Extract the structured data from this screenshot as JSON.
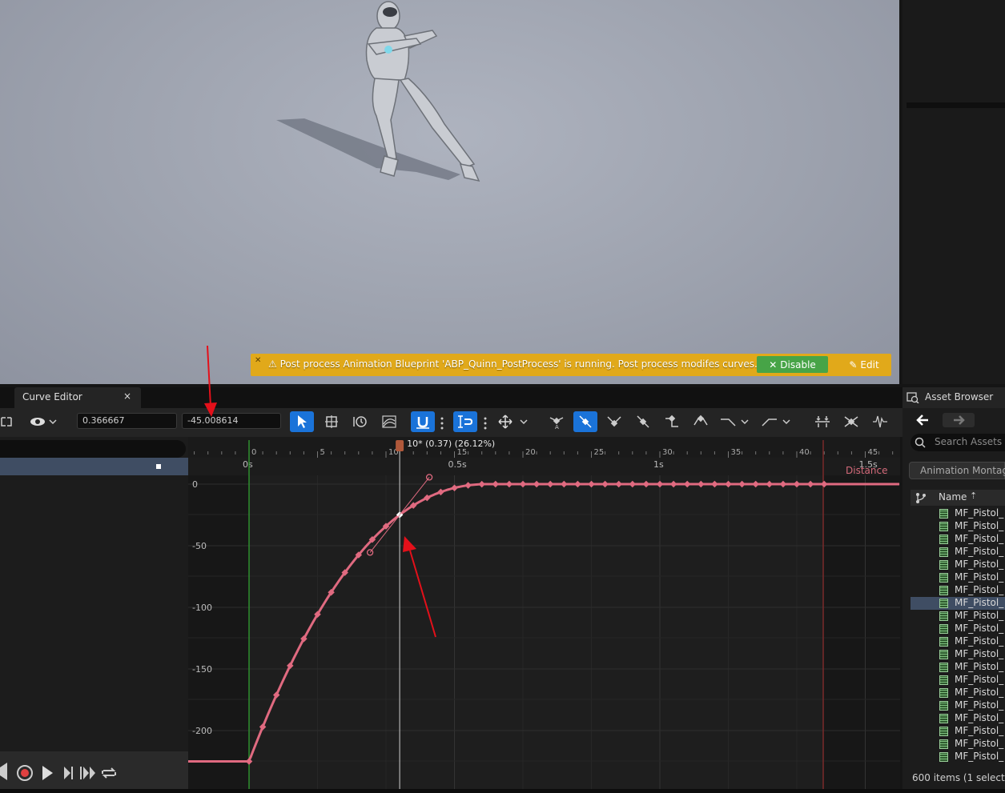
{
  "notification": {
    "message": "Post process Animation Blueprint 'ABP_Quinn_PostProcess' is running. Post process modifes curves.",
    "disable_label": "Disable",
    "edit_label": "Edit",
    "color": "#e1a91a"
  },
  "curve_editor": {
    "tab_title": "Curve Editor",
    "close_glyph": "×",
    "time_value": "0.366667",
    "key_value": "-45.008614",
    "scrubber_label": "10* (0.37) (26.12%)",
    "curve_name": "Distance",
    "frame_ticks": [
      "5",
      "0",
      "5",
      "10",
      "15",
      "20",
      "25",
      "30",
      "35",
      "40",
      "45"
    ],
    "time_ticks": [
      "0s",
      "0.5s",
      "1s",
      "1.5s"
    ],
    "value_ticks": [
      "0",
      "-50",
      "-100",
      "-150",
      "-200"
    ],
    "curve_color": "#e06a80",
    "accent_color": "#1a73d9"
  },
  "asset_browser": {
    "title": "Asset Browser",
    "search_placeholder": "Search Assets",
    "filter_label": "Animation Montage",
    "column_name": "Name",
    "items": [
      "MF_Pistol_",
      "MF_Pistol_",
      "MF_Pistol_",
      "MF_Pistol_",
      "MF_Pistol_",
      "MF_Pistol_",
      "MF_Pistol_",
      "MF_Pistol_",
      "MF_Pistol_",
      "MF_Pistol_",
      "MF_Pistol_",
      "MF_Pistol_",
      "MF_Pistol_",
      "MF_Pistol_",
      "MF_Pistol_",
      "MF_Pistol_",
      "MF_Pistol_",
      "MF_Pistol_",
      "MF_Pistol_",
      "MF_Pistol_"
    ],
    "selected_index": 7,
    "status": "600 items (1 selecte"
  }
}
